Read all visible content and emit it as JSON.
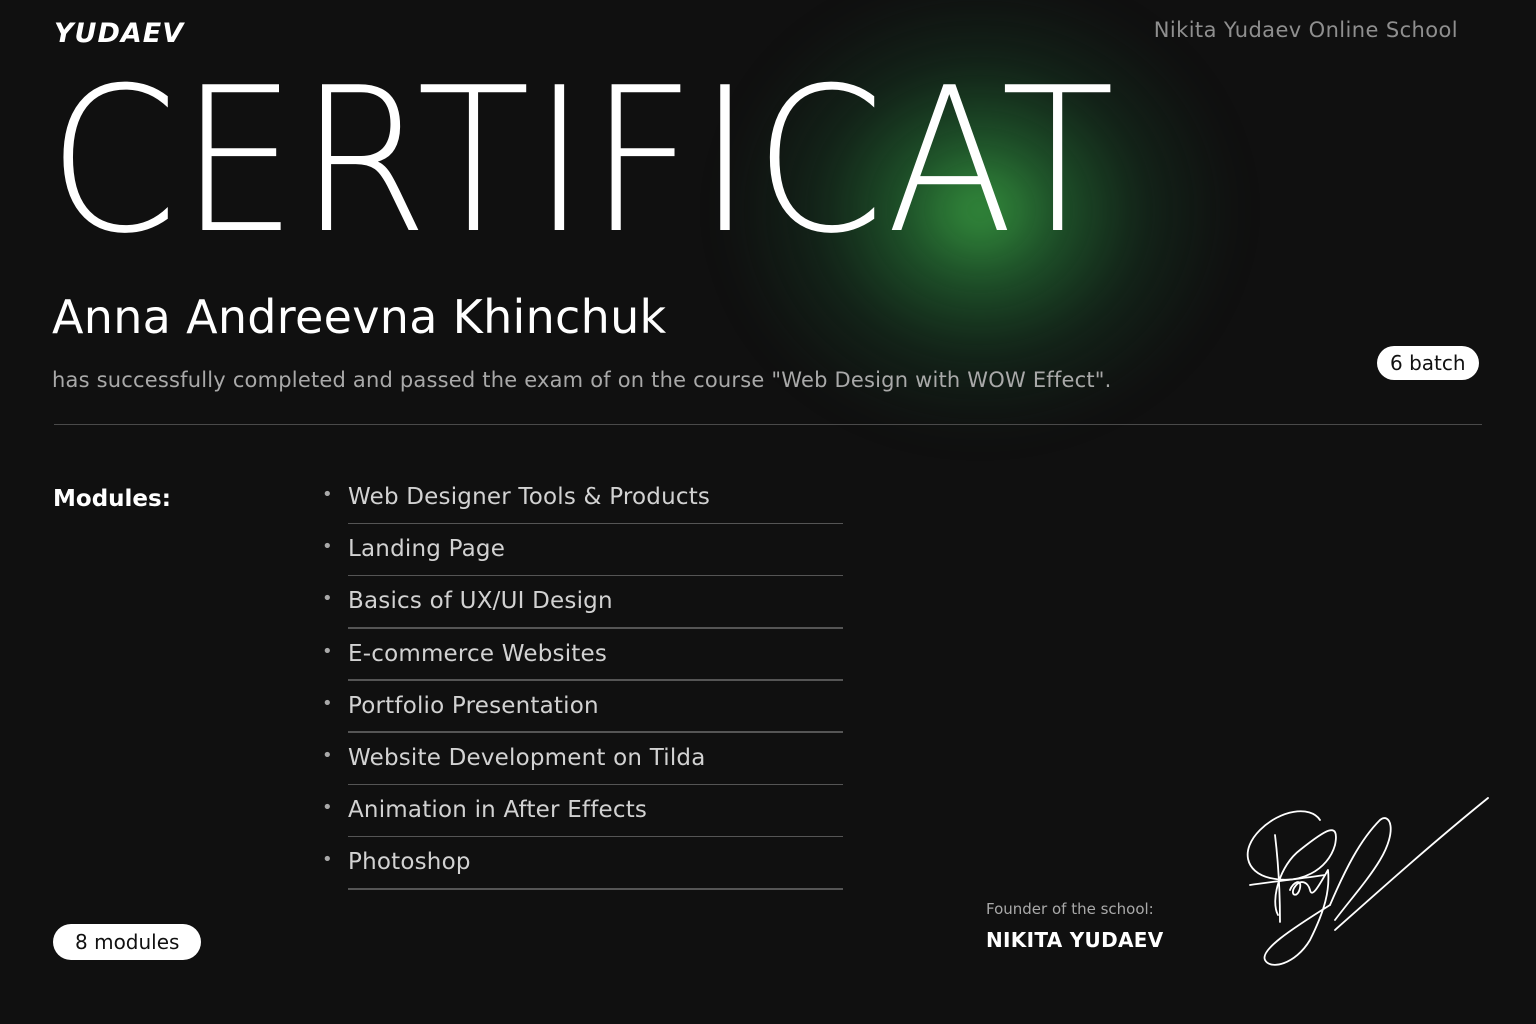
{
  "header": {
    "logo": "YUDAEV",
    "school": "Nikita Yudaev Online School"
  },
  "certificate": {
    "title": "CERTIFICAT",
    "recipient": "Anna Andreevna Khinchuk",
    "description": "has successfully completed and passed the exam of on the course \"Web Design with WOW Effect\".",
    "batch": "6 batch"
  },
  "modules": {
    "label": "Modules:",
    "items": [
      "Web Designer Tools & Products",
      "Landing Page",
      "Basics of UX/UI Design",
      "E-commerce Websites",
      "Portfolio Presentation",
      "Website Development on Tilda",
      "Animation in After Effects",
      "Photoshop"
    ],
    "count": "8 modules",
    "bullet": "•"
  },
  "founder": {
    "caption": "Founder of the school:",
    "name": "NIKITA YUDAEV"
  },
  "colors": {
    "background": "#101010",
    "accent_glow": "#3caa46",
    "text_primary": "#ffffff",
    "text_secondary": "#a9a9a9"
  }
}
